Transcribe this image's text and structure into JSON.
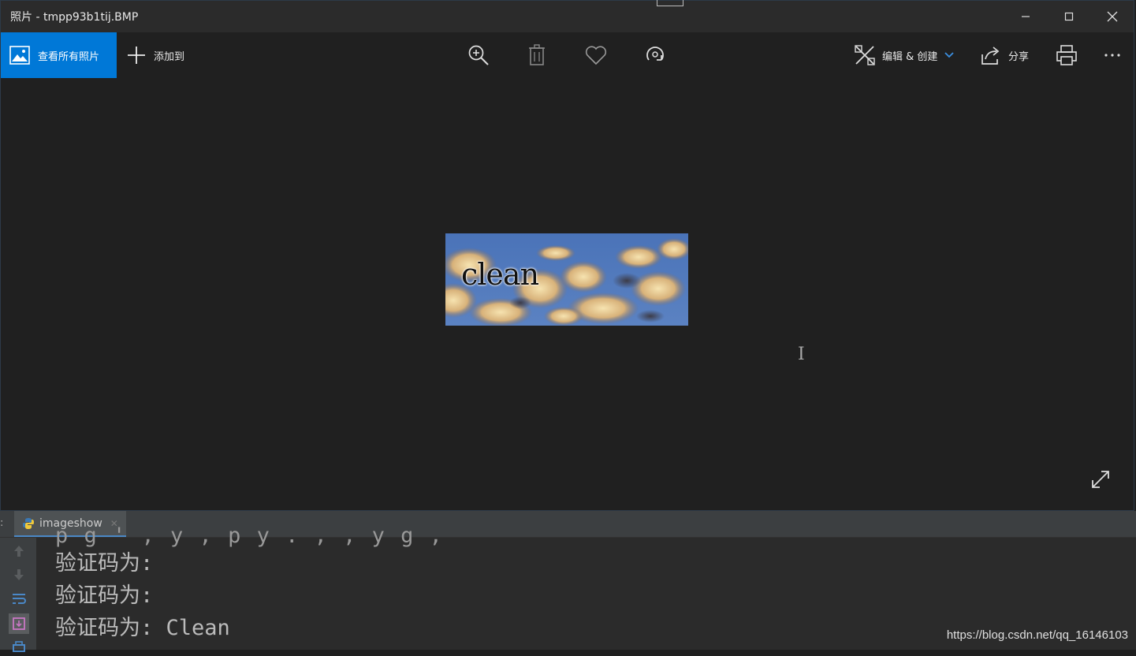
{
  "window": {
    "title": "照片 - tmpp93b1tij.BMP"
  },
  "toolbar": {
    "view_all_label": "查看所有照片",
    "add_to_label": "添加到",
    "edit_create_label": "编辑 & 创建",
    "share_label": "分享"
  },
  "photo": {
    "text": "clean"
  },
  "ide": {
    "tab_prefix": ":",
    "run_tab_label": "imageshow",
    "console_partial": "  p  g    '  ,  y   ,  p  y        .  ,   ,  y      g  ,",
    "console_lines": [
      "验证码为:",
      "验证码为:",
      "验证码为: Clean"
    ]
  },
  "watermark": "https://blog.csdn.net/qq_16146103",
  "colors": {
    "accent": "#0078d7",
    "window_bg": "#202020",
    "titlebar_bg": "#2b2b2b",
    "ide_bg": "#2b2b2b"
  }
}
